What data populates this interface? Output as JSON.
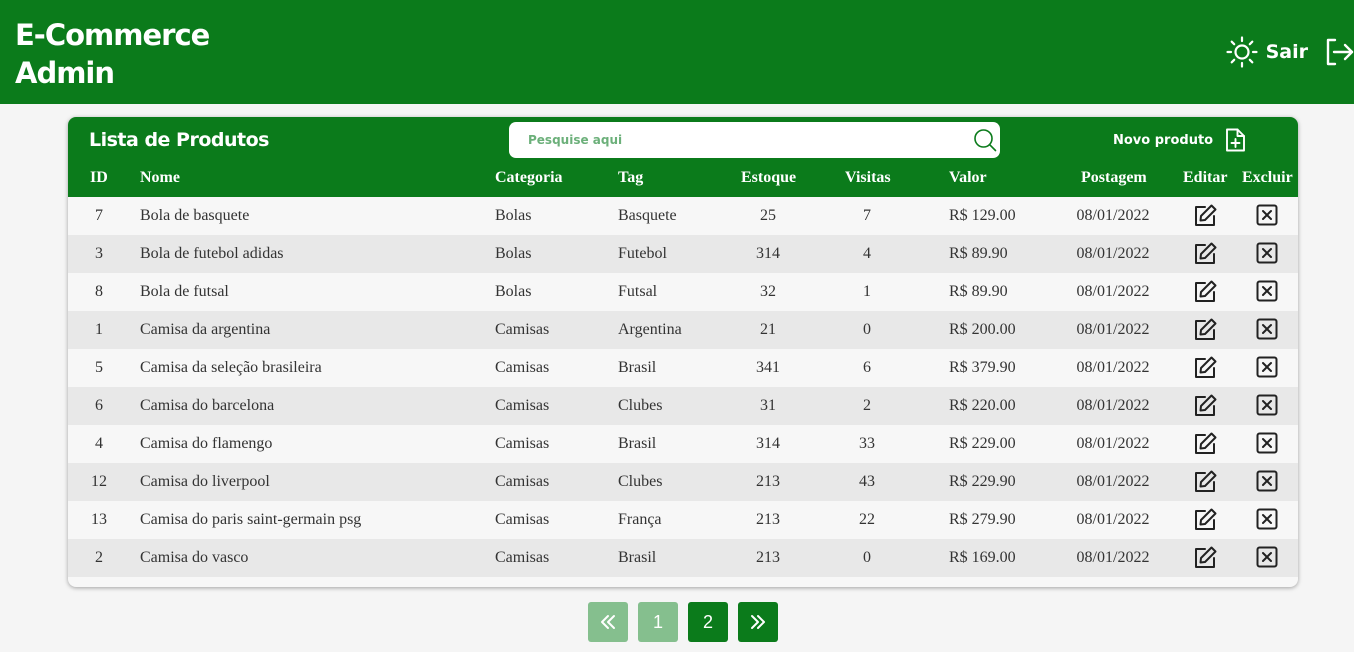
{
  "header": {
    "brand_line1": "E-Commerce",
    "brand_line2": "Admin",
    "logout_label": "Sair",
    "theme_icon": "sun-icon",
    "logout_icon": "logout-icon"
  },
  "colors": {
    "primary": "#0b7b1b",
    "primary_light": "#85bf8e",
    "row_alt": "#e8e8e8",
    "page_bg": "#f5f5f5"
  },
  "products": {
    "title": "Lista de Produtos",
    "search_placeholder": "Pesquise aqui",
    "new_product_label": "Novo produto",
    "columns": [
      "ID",
      "Nome",
      "Categoria",
      "Tag",
      "Estoque",
      "Visitas",
      "Valor",
      "Postagem",
      "Editar",
      "Excluir"
    ],
    "rows": [
      {
        "id": "7",
        "nome": "Bola de basquete",
        "categoria": "Bolas",
        "tag": "Basquete",
        "estoque": "25",
        "visitas": "7",
        "valor": "R$ 129.00",
        "postagem": "08/01/2022"
      },
      {
        "id": "3",
        "nome": "Bola de futebol adidas",
        "categoria": "Bolas",
        "tag": "Futebol",
        "estoque": "314",
        "visitas": "4",
        "valor": "R$ 89.90",
        "postagem": "08/01/2022"
      },
      {
        "id": "8",
        "nome": "Bola de futsal",
        "categoria": "Bolas",
        "tag": "Futsal",
        "estoque": "32",
        "visitas": "1",
        "valor": "R$ 89.90",
        "postagem": "08/01/2022"
      },
      {
        "id": "1",
        "nome": "Camisa da argentina",
        "categoria": "Camisas",
        "tag": "Argentina",
        "estoque": "21",
        "visitas": "0",
        "valor": "R$ 200.00",
        "postagem": "08/01/2022"
      },
      {
        "id": "5",
        "nome": "Camisa da seleção brasileira",
        "categoria": "Camisas",
        "tag": "Brasil",
        "estoque": "341",
        "visitas": "6",
        "valor": "R$ 379.90",
        "postagem": "08/01/2022"
      },
      {
        "id": "6",
        "nome": "Camisa do barcelona",
        "categoria": "Camisas",
        "tag": "Clubes",
        "estoque": "31",
        "visitas": "2",
        "valor": "R$ 220.00",
        "postagem": "08/01/2022"
      },
      {
        "id": "4",
        "nome": "Camisa do flamengo",
        "categoria": "Camisas",
        "tag": "Brasil",
        "estoque": "314",
        "visitas": "33",
        "valor": "R$ 229.00",
        "postagem": "08/01/2022"
      },
      {
        "id": "12",
        "nome": "Camisa do liverpool",
        "categoria": "Camisas",
        "tag": "Clubes",
        "estoque": "213",
        "visitas": "43",
        "valor": "R$ 229.90",
        "postagem": "08/01/2022"
      },
      {
        "id": "13",
        "nome": "Camisa do paris saint-germain psg",
        "categoria": "Camisas",
        "tag": "França",
        "estoque": "213",
        "visitas": "22",
        "valor": "R$ 279.90",
        "postagem": "08/01/2022"
      },
      {
        "id": "2",
        "nome": "Camisa do vasco",
        "categoria": "Camisas",
        "tag": "Brasil",
        "estoque": "213",
        "visitas": "0",
        "valor": "R$ 169.00",
        "postagem": "08/01/2022"
      }
    ]
  },
  "pagination": {
    "first_icon": "chevrons-left-icon",
    "pages": [
      "1",
      "2"
    ],
    "current_page": "2",
    "last_icon": "chevrons-right-icon"
  }
}
